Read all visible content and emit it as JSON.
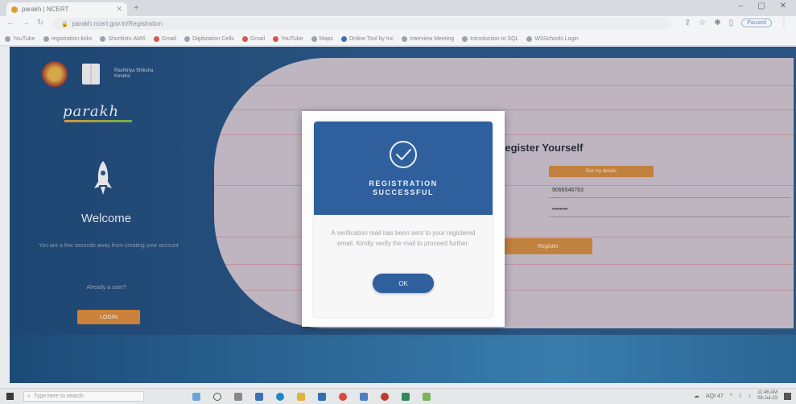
{
  "browser": {
    "tab_title": "parakh | NCERT",
    "url": "parakh.ncert.gov.in/Registration",
    "new_tab_symbol": "+",
    "window_controls": [
      "–",
      "▢",
      "✕"
    ],
    "profile_button": "Paused",
    "bookmarks": [
      {
        "label": "YouTube",
        "color": "#9aa3ad"
      },
      {
        "label": "registration-links",
        "color": "#9aa3ad"
      },
      {
        "label": "Shortlists-AMS",
        "color": "#9aa3ad"
      },
      {
        "label": "Gmail",
        "color": "#d9534f"
      },
      {
        "label": "Digitization Cells",
        "color": "#9aa3ad"
      },
      {
        "label": "Gmail",
        "color": "#d9534f"
      },
      {
        "label": "YouTube",
        "color": "#d9534f"
      },
      {
        "label": "Maps",
        "color": "#9aa3ad"
      },
      {
        "label": "Online Tool by Inc",
        "color": "#3b6fb6"
      },
      {
        "label": "Interview Meeting",
        "color": "#9aa3ad"
      },
      {
        "label": "Introduction to SQL",
        "color": "#9aa3ad"
      },
      {
        "label": "W3Schools Login",
        "color": "#9aa3ad"
      }
    ]
  },
  "left_panel": {
    "brand": "parakh",
    "logo_caption": "Rashtriya Shiksha Kendra",
    "welcome_title": "Welcome",
    "welcome_text": "You are a few seconds away from creating your account",
    "already_text": "Already a user?",
    "login_button": "LOGIN"
  },
  "register_form": {
    "title": "Register Yourself",
    "top_button": "Get my details",
    "mobile_value": "9066546763",
    "password_value": "••••••••",
    "register_button": "Register"
  },
  "modal": {
    "title_line1": "REGISTRATION",
    "title_line2": "SUCCESSFUL",
    "message": "A verification mail has been sent to your registered email. Kindly verify the mail to proceed further.",
    "ok_button": "OK",
    "accent_color": "#2f5f9d"
  },
  "taskbar": {
    "search_placeholder": "Type here to search",
    "tray_text": "AQI 47",
    "time": "11:46 AM",
    "date": "08-Jul-23"
  }
}
